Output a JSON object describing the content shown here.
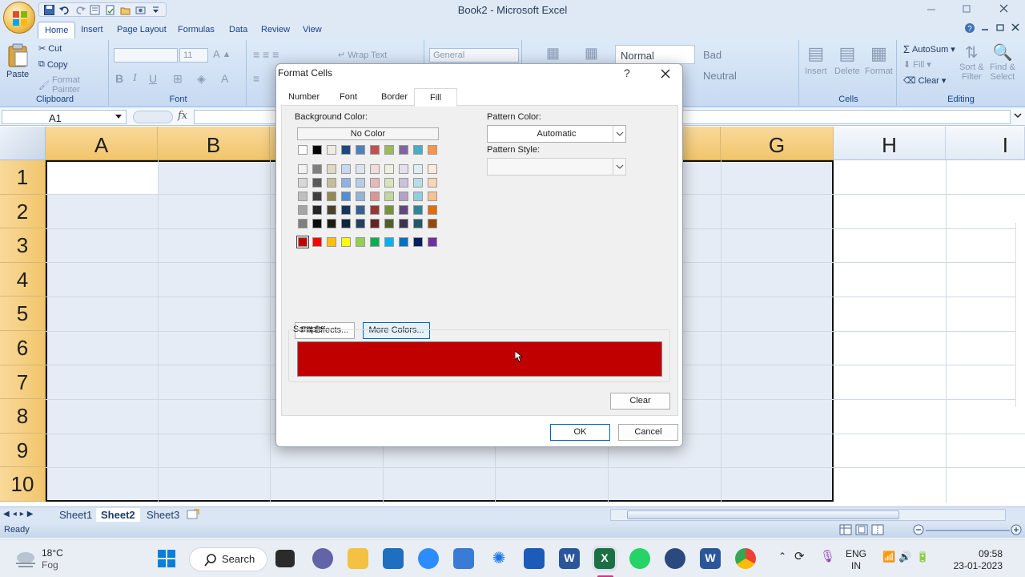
{
  "window": {
    "title": "Book2 - Microsoft Excel"
  },
  "ribbon_tabs": [
    "Home",
    "Insert",
    "Page Layout",
    "Formulas",
    "Data",
    "Review",
    "View"
  ],
  "ribbon": {
    "clipboard": {
      "paste": "Paste",
      "cut": "Cut",
      "copy": "Copy",
      "format_painter": "Format Painter",
      "label": "Clipboard"
    },
    "font": {
      "size": "11",
      "label": "Font"
    },
    "alignment": {
      "wrap_text": "Wrap Text"
    },
    "number": {
      "format": "General"
    },
    "styles": {
      "normal": "Normal",
      "bad": "Bad",
      "neutral": "Neutral"
    },
    "cells": {
      "insert": "Insert",
      "delete": "Delete",
      "format": "Format",
      "label": "Cells"
    },
    "editing": {
      "autosum": "AutoSum",
      "fill": "Fill",
      "clear": "Clear",
      "sort_filter_1": "Sort &",
      "sort_filter_2": "Filter",
      "find_select_1": "Find &",
      "find_select_2": "Select",
      "label": "Editing"
    }
  },
  "formula_bar": {
    "name_box": "A1",
    "fx": "fx",
    "formula": ""
  },
  "grid": {
    "columns": [
      "A",
      "B",
      "C",
      "D",
      "E",
      "F",
      "G",
      "H",
      "I"
    ],
    "rows": [
      "1",
      "2",
      "3",
      "4",
      "5",
      "6",
      "7",
      "8",
      "9",
      "10"
    ],
    "active_cell": "A1"
  },
  "sheets": {
    "tabs": [
      "Sheet1",
      "Sheet2",
      "Sheet3"
    ],
    "active": "Sheet2"
  },
  "status": {
    "text": "Ready"
  },
  "dialog": {
    "title": "Format Cells",
    "help": "?",
    "tabs": [
      "Number",
      "Font",
      "Border",
      "Fill"
    ],
    "active_tab": "Fill",
    "background_color_label": "Background Color:",
    "no_color": "No Color",
    "pattern_color_label": "Pattern Color:",
    "pattern_color_value": "Automatic",
    "pattern_style_label": "Pattern Style:",
    "pattern_style_value": "",
    "fill_effects": "Fill Effects...",
    "more_colors": "More Colors...",
    "sample_label": "Sample",
    "sample_color": "#C00000",
    "clear": "Clear",
    "ok": "OK",
    "cancel": "Cancel",
    "theme_colors_top": [
      "#FFFFFF",
      "#000000",
      "#EEECE1",
      "#1F497D",
      "#4F81BD",
      "#C0504D",
      "#9BBB59",
      "#8064A2",
      "#4BACC6",
      "#F79646"
    ],
    "theme_tints": [
      [
        "#F2F2F2",
        "#7F7F7F",
        "#DDD9C3",
        "#C6D9F0",
        "#DBE5F1",
        "#F2DCDB",
        "#EBF1DD",
        "#E5E0EC",
        "#DBEEF3",
        "#FDEADA"
      ],
      [
        "#D8D8D8",
        "#595959",
        "#C4BD97",
        "#8DB3E2",
        "#B8CCE4",
        "#E5B9B7",
        "#D7E3BC",
        "#CCC1D9",
        "#B7DDE8",
        "#FBD5B5"
      ],
      [
        "#BFBFBF",
        "#3F3F3F",
        "#938953",
        "#548DD4",
        "#95B3D7",
        "#D99694",
        "#C3D69B",
        "#B2A2C7",
        "#92CDDC",
        "#FAC08F"
      ],
      [
        "#A5A5A5",
        "#262626",
        "#494429",
        "#17365D",
        "#366092",
        "#953734",
        "#76923C",
        "#5F497A",
        "#31859B",
        "#E36C09"
      ],
      [
        "#7F7F7F",
        "#0C0C0C",
        "#1D1B10",
        "#0F243E",
        "#244061",
        "#632423",
        "#4F6128",
        "#3F3151",
        "#205867",
        "#974806"
      ]
    ],
    "standard_colors": [
      "#C00000",
      "#FF0000",
      "#FFC000",
      "#FFFF00",
      "#92D050",
      "#00B050",
      "#00B0F0",
      "#0070C0",
      "#002060",
      "#7030A0"
    ],
    "selected_color": "#C00000"
  },
  "taskbar": {
    "weather_temp": "18°C",
    "weather_cond": "Fog",
    "search": "Search",
    "lang_1": "ENG",
    "lang_2": "IN",
    "time": "09:58",
    "date": "23-01-2023"
  }
}
